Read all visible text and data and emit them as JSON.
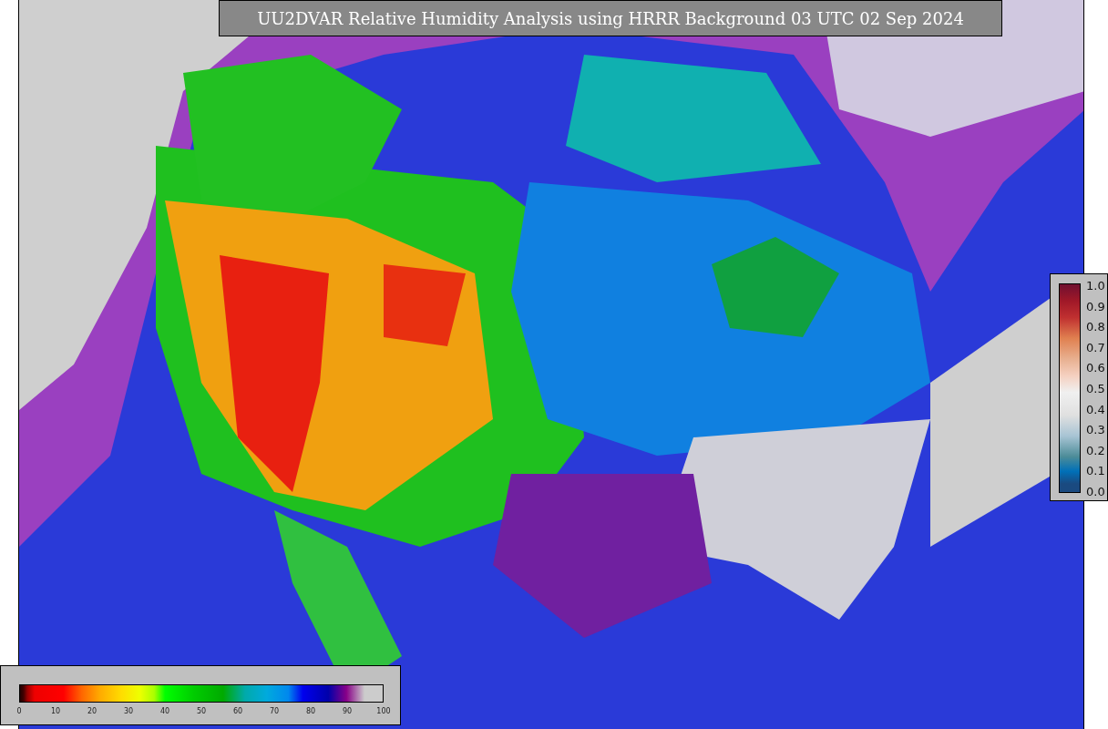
{
  "title": "UU2DVAR Relative Humidity Analysis using HRRR Background 03 UTC 02 Sep 2024",
  "humidity_colorbar": {
    "ticks": [
      "0",
      "10",
      "20",
      "30",
      "40",
      "50",
      "60",
      "70",
      "80",
      "90",
      "100"
    ]
  },
  "station_colorbar": {
    "ticks": [
      "1.0",
      "0.9",
      "0.8",
      "0.7",
      "0.6",
      "0.5",
      "0.4",
      "0.3",
      "0.2",
      "0.1",
      "0.0"
    ]
  }
}
